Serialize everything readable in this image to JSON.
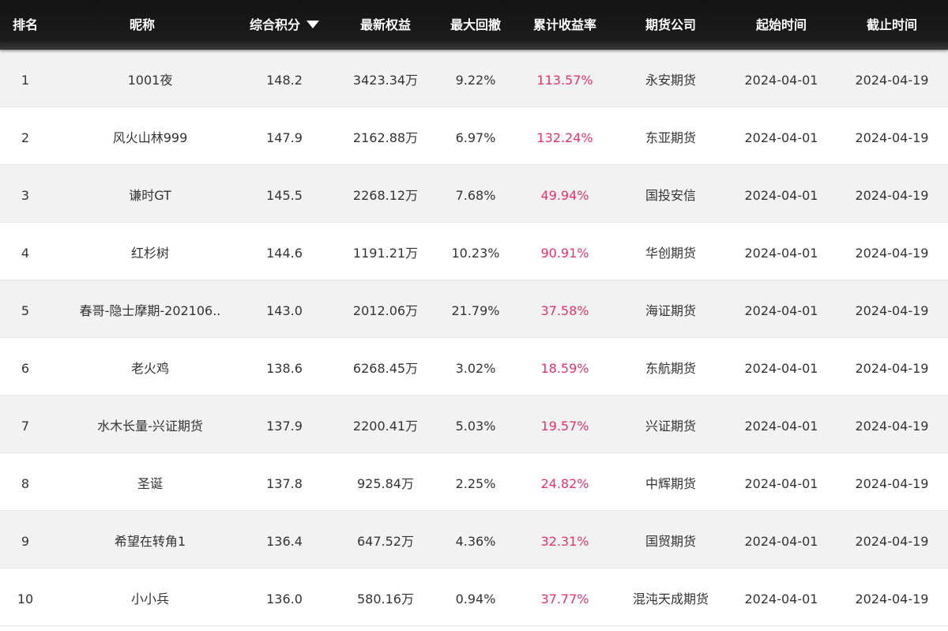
{
  "header": {
    "rank": "排名",
    "nickname": "昵称",
    "score": "综合积分",
    "equity": "最新权益",
    "max_drawdown": "最大回撤",
    "cum_return": "累计收益率",
    "broker": "期货公司",
    "start": "起始时间",
    "end": "截止时间"
  },
  "colors": {
    "header_bg": "#1b1b1b",
    "positive_return": "#e7336a",
    "row_stripe": "#f2f2f2"
  },
  "rows": [
    {
      "rank": "1",
      "nickname": "1001夜",
      "score": "148.2",
      "equity": "3423.34万",
      "max_drawdown": "9.22%",
      "cum_return": "113.57%",
      "broker": "永安期货",
      "start": "2024-04-01",
      "end": "2024-04-19"
    },
    {
      "rank": "2",
      "nickname": "风火山林999",
      "score": "147.9",
      "equity": "2162.88万",
      "max_drawdown": "6.97%",
      "cum_return": "132.24%",
      "broker": "东亚期货",
      "start": "2024-04-01",
      "end": "2024-04-19"
    },
    {
      "rank": "3",
      "nickname": "谦时GT",
      "score": "145.5",
      "equity": "2268.12万",
      "max_drawdown": "7.68%",
      "cum_return": "49.94%",
      "broker": "国投安信",
      "start": "2024-04-01",
      "end": "2024-04-19"
    },
    {
      "rank": "4",
      "nickname": "红杉树",
      "score": "144.6",
      "equity": "1191.21万",
      "max_drawdown": "10.23%",
      "cum_return": "90.91%",
      "broker": "华创期货",
      "start": "2024-04-01",
      "end": "2024-04-19"
    },
    {
      "rank": "5",
      "nickname": "春哥-隐士摩期-202106..",
      "score": "143.0",
      "equity": "2012.06万",
      "max_drawdown": "21.79%",
      "cum_return": "37.58%",
      "broker": "海证期货",
      "start": "2024-04-01",
      "end": "2024-04-19"
    },
    {
      "rank": "6",
      "nickname": "老火鸡",
      "score": "138.6",
      "equity": "6268.45万",
      "max_drawdown": "3.02%",
      "cum_return": "18.59%",
      "broker": "东航期货",
      "start": "2024-04-01",
      "end": "2024-04-19"
    },
    {
      "rank": "7",
      "nickname": "水木长量-兴证期货",
      "score": "137.9",
      "equity": "2200.41万",
      "max_drawdown": "5.03%",
      "cum_return": "19.57%",
      "broker": "兴证期货",
      "start": "2024-04-01",
      "end": "2024-04-19"
    },
    {
      "rank": "8",
      "nickname": "圣诞",
      "score": "137.8",
      "equity": "925.84万",
      "max_drawdown": "2.25%",
      "cum_return": "24.82%",
      "broker": "中辉期货",
      "start": "2024-04-01",
      "end": "2024-04-19"
    },
    {
      "rank": "9",
      "nickname": "希望在转角1",
      "score": "136.4",
      "equity": "647.52万",
      "max_drawdown": "4.36%",
      "cum_return": "32.31%",
      "broker": "国贸期货",
      "start": "2024-04-01",
      "end": "2024-04-19"
    },
    {
      "rank": "10",
      "nickname": "小小兵",
      "score": "136.0",
      "equity": "580.16万",
      "max_drawdown": "0.94%",
      "cum_return": "37.77%",
      "broker": "混沌天成期货",
      "start": "2024-04-01",
      "end": "2024-04-19"
    }
  ]
}
